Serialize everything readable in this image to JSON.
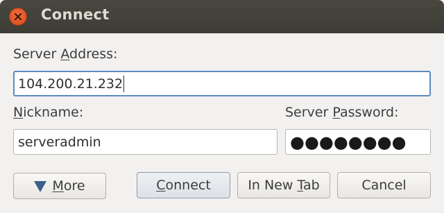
{
  "window": {
    "title": "Connect"
  },
  "form": {
    "server_address": {
      "label_pre": "Server ",
      "label_accel": "A",
      "label_post": "ddress:",
      "value": "104.200.21.232"
    },
    "nickname": {
      "label_accel": "N",
      "label_post": "ickname:",
      "value": "serveradmin"
    },
    "server_password": {
      "label_pre": "Server ",
      "label_accel": "P",
      "label_post": "assword:",
      "value": "●●●●●●●●"
    }
  },
  "buttons": {
    "more": {
      "label_accel": "M",
      "label_post": "ore"
    },
    "connect": {
      "label_accel": "C",
      "label_post": "onnect"
    },
    "new_tab": {
      "label_pre": "In New ",
      "label_accel": "T",
      "label_post": "ab"
    },
    "cancel": {
      "label": "Cancel"
    }
  },
  "icons": {
    "close": "close-icon",
    "more": "triangle-down-icon"
  },
  "colors": {
    "titlebar": "#3d3c36",
    "close_button": "#e95420",
    "focus_border": "#5b8ac2",
    "background": "#f2f1f0"
  }
}
